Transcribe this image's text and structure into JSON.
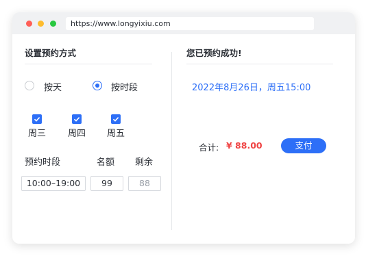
{
  "browser": {
    "url": "https://www.longyixiu.com"
  },
  "left_panel": {
    "title": "设置预约方式",
    "mode_options": [
      {
        "label": "按天",
        "selected": false
      },
      {
        "label": "按时段",
        "selected": true
      }
    ],
    "weekdays": [
      {
        "label": "周三",
        "checked": true
      },
      {
        "label": "周四",
        "checked": true
      },
      {
        "label": "周五",
        "checked": true
      }
    ],
    "columns": {
      "period": "预约时段",
      "quota": "名额",
      "remaining": "剩余"
    },
    "period_value": "10:00–19:00",
    "quota_value": "99",
    "remaining_value": "88"
  },
  "right_panel": {
    "title": "您已预约成功!",
    "appointment": "2022年8月26日，周五15:00",
    "total_label": "合计:",
    "total_amount": "¥ 88.00",
    "pay_button": "支付"
  },
  "colors": {
    "accent": "#2d6ff7",
    "price": "#ef4444"
  }
}
